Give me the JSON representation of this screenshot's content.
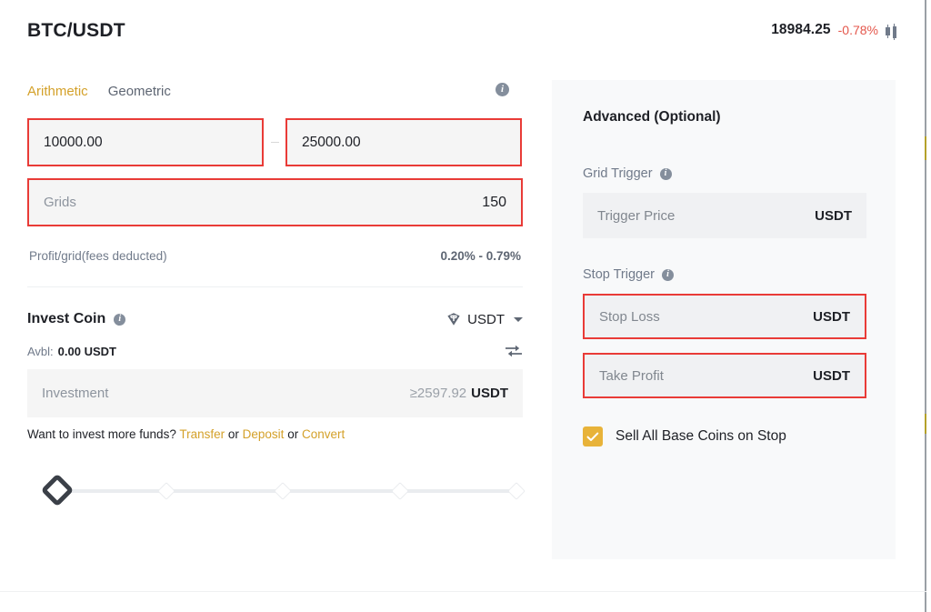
{
  "header": {
    "pair": "BTC/USDT",
    "last_price": "18984.25",
    "price_change": "-0.78%",
    "price_change_color": "#e4574c",
    "chart_icon": "candlestick-icon"
  },
  "grid_mode": {
    "tabs": [
      {
        "label": "Arithmetic",
        "active": true
      },
      {
        "label": "Geometric",
        "active": false
      }
    ],
    "info_icon": "info-icon"
  },
  "price_range": {
    "lower_value": "10000.00",
    "upper_value": "25000.00",
    "separator": "-"
  },
  "grids": {
    "placeholder": "Grids",
    "value": "150"
  },
  "profit": {
    "label": "Profit/grid(fees deducted)",
    "value": "0.20% - 0.79%"
  },
  "invest": {
    "title": "Invest Coin",
    "info_icon": "info-icon",
    "coin": "USDT",
    "coin_icon": "tether-icon",
    "chevron_icon": "chevron-down-icon",
    "avbl_label": "Avbl:",
    "avbl_value": "0.00 USDT",
    "swap_icon": "swap-icon",
    "investment_placeholder": "Investment",
    "investment_min": "≥2597.92",
    "investment_unit": "USDT",
    "more_funds_text": "Want to invest more funds?",
    "link_transfer": "Transfer",
    "or_1": "or",
    "link_deposit": "Deposit",
    "or_2": "or",
    "link_convert": "Convert",
    "link_color": "#d4a12a"
  },
  "slider": {
    "handle_position_pct": 0,
    "ticks": [
      0,
      25,
      50,
      75,
      100
    ]
  },
  "advanced": {
    "title": "Advanced (Optional)",
    "grid_trigger": {
      "label": "Grid Trigger",
      "info_icon": "info-icon",
      "field_placeholder": "Trigger Price",
      "field_unit": "USDT"
    },
    "stop_trigger": {
      "label": "Stop Trigger",
      "info_icon": "info-icon",
      "stop_loss_placeholder": "Stop Loss",
      "stop_loss_unit": "USDT",
      "take_profit_placeholder": "Take Profit",
      "take_profit_unit": "USDT"
    },
    "sell_all": {
      "label": "Sell All Base Coins on Stop",
      "checked": true,
      "checkbox_color": "#e8b339"
    }
  },
  "highlight_color": "#e93b37"
}
